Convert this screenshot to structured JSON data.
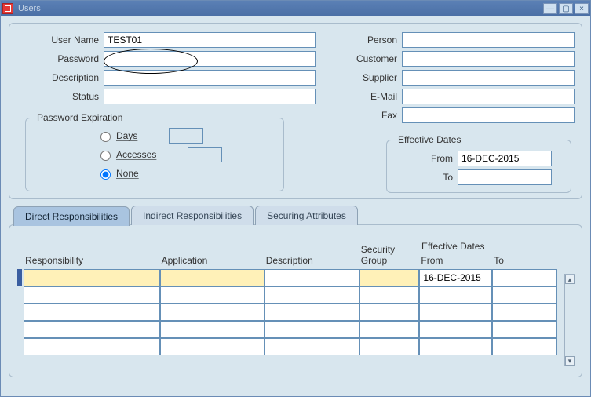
{
  "window": {
    "title": "Users"
  },
  "leftFields": {
    "userName": {
      "label": "User Name",
      "value": "TEST01"
    },
    "password": {
      "label": "Password",
      "value": ""
    },
    "description": {
      "label": "Description",
      "value": ""
    },
    "status": {
      "label": "Status",
      "value": ""
    }
  },
  "rightFields": {
    "person": {
      "label": "Person",
      "value": ""
    },
    "customer": {
      "label": "Customer",
      "value": ""
    },
    "supplier": {
      "label": "Supplier",
      "value": ""
    },
    "email": {
      "label": "E-Mail",
      "value": ""
    },
    "fax": {
      "label": "Fax",
      "value": ""
    }
  },
  "passwordExpiration": {
    "title": "Password Expiration",
    "options": {
      "days": "Days",
      "accesses": "Accesses",
      "none": "None"
    },
    "selected": "none",
    "daysValue": "",
    "accessesValue": ""
  },
  "effectiveDates": {
    "title": "Effective Dates",
    "fromLabel": "From",
    "toLabel": "To",
    "from": "16-DEC-2015",
    "to": ""
  },
  "tabs": {
    "direct": "Direct Responsibilities",
    "indirect": "Indirect Responsibilities",
    "securing": "Securing Attributes"
  },
  "grid": {
    "effDatesHeader": "Effective Dates",
    "columns": {
      "responsibility": "Responsibility",
      "application": "Application",
      "description": "Description",
      "securityGroup": "Security\nGroup",
      "from": "From",
      "to": "To"
    },
    "rows": [
      {
        "responsibility": "",
        "application": "",
        "description": "",
        "securityGroup": "",
        "from": "16-DEC-2015",
        "to": ""
      },
      {
        "responsibility": "",
        "application": "",
        "description": "",
        "securityGroup": "",
        "from": "",
        "to": ""
      },
      {
        "responsibility": "",
        "application": "",
        "description": "",
        "securityGroup": "",
        "from": "",
        "to": ""
      },
      {
        "responsibility": "",
        "application": "",
        "description": "",
        "securityGroup": "",
        "from": "",
        "to": ""
      },
      {
        "responsibility": "",
        "application": "",
        "description": "",
        "securityGroup": "",
        "from": "",
        "to": ""
      }
    ]
  }
}
